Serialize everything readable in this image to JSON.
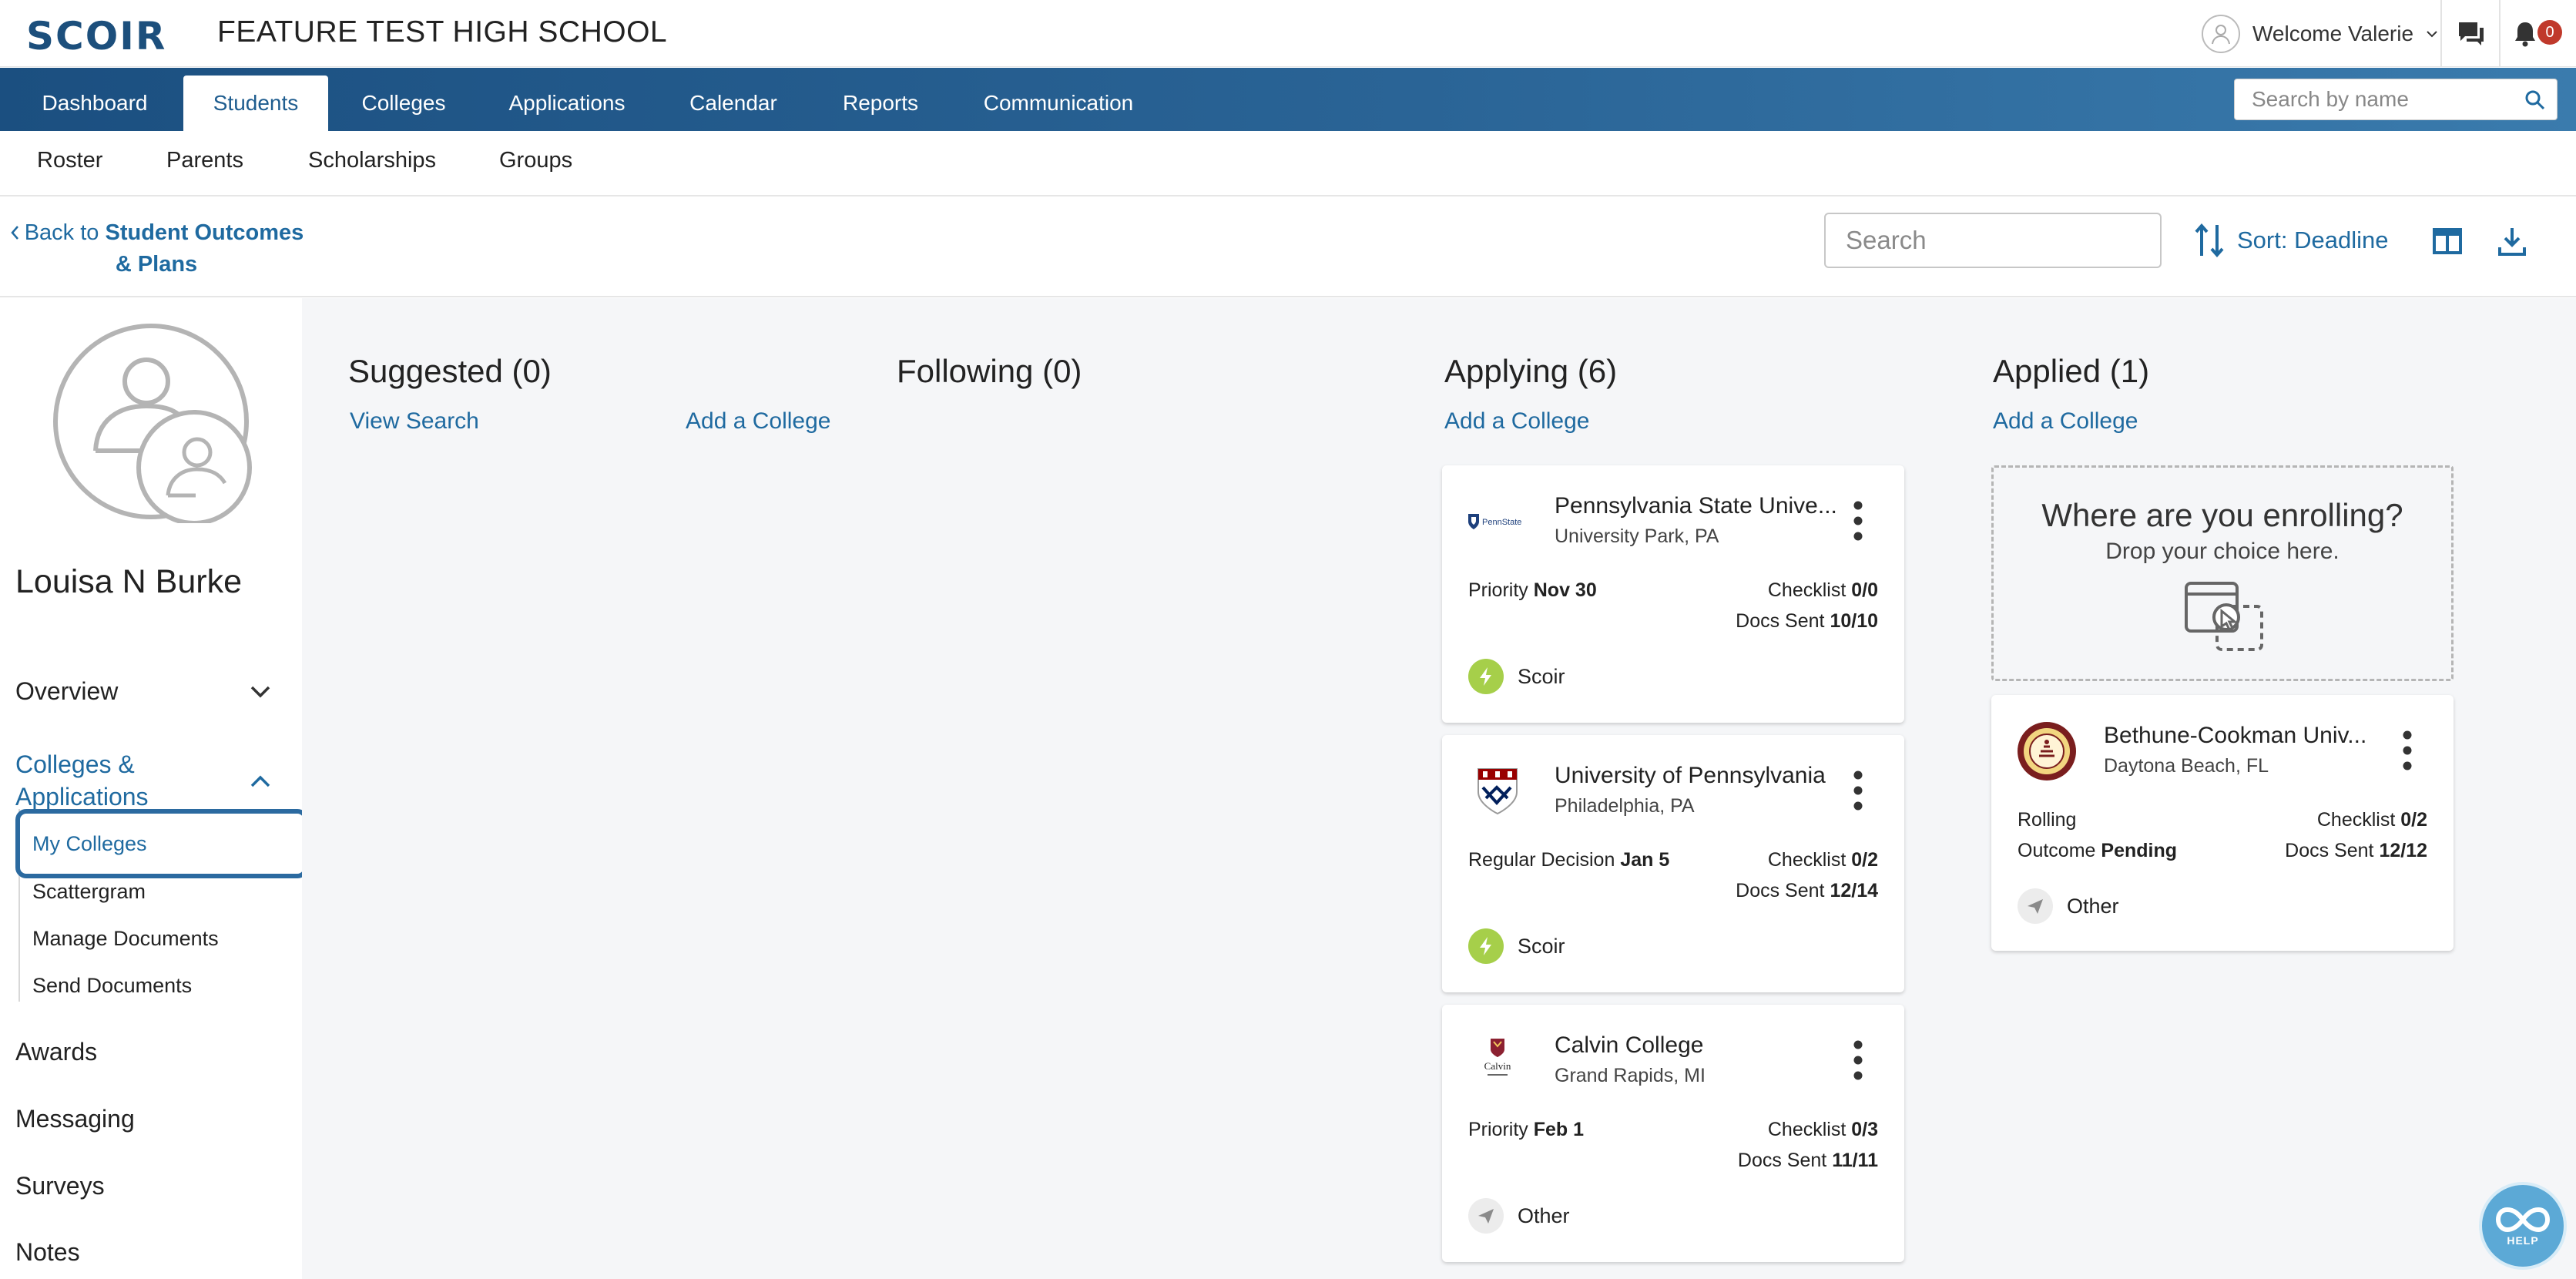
{
  "header": {
    "logo": "SCOIR",
    "school_name": "FEATURE TEST HIGH SCHOOL",
    "welcome": "Welcome Valerie",
    "notification_count": "0"
  },
  "main_nav": {
    "tabs": [
      "Dashboard",
      "Students",
      "Colleges",
      "Applications",
      "Calendar",
      "Reports",
      "Communication"
    ],
    "active": "Students",
    "search_placeholder": "Search by name"
  },
  "sub_nav": {
    "items": [
      "Roster",
      "Parents",
      "Scholarships",
      "Groups"
    ]
  },
  "toolbar": {
    "back_prefix": "Back to ",
    "back_target": "Student Outcomes & Plans",
    "search_placeholder": "Search",
    "sort_label": "Sort: Deadline"
  },
  "sidebar": {
    "student_name": "Louisa N Burke",
    "overview": "Overview",
    "colleges_apps": "Colleges & Applications",
    "sub_items": [
      "My Colleges",
      "Scattergram",
      "Manage Documents",
      "Send Documents"
    ],
    "links": [
      "Awards",
      "Messaging",
      "Surveys",
      "Notes"
    ]
  },
  "columns": {
    "suggested": {
      "title": "Suggested (0)",
      "view_search": "View Search",
      "add": "Add a College"
    },
    "following": {
      "title": "Following (0)"
    },
    "applying": {
      "title": "Applying (6)",
      "add": "Add a College"
    },
    "applied": {
      "title": "Applied (1)",
      "add": "Add a College"
    }
  },
  "applying_cards": [
    {
      "name": "Pennsylvania State Unive...",
      "location": "University Park, PA",
      "deadline_type": "Priority",
      "deadline": "Nov 30",
      "checklist": "0/0",
      "docs_sent": "10/10",
      "method": "Scoir"
    },
    {
      "name": "University of Pennsylvania",
      "location": "Philadelphia, PA",
      "deadline_type": "Regular Decision",
      "deadline": "Jan 5",
      "checklist": "0/2",
      "docs_sent": "12/14",
      "method": "Scoir"
    },
    {
      "name": "Calvin College",
      "location": "Grand Rapids, MI",
      "deadline_type": "Priority",
      "deadline": "Feb 1",
      "checklist": "0/3",
      "docs_sent": "11/11",
      "method": "Other"
    }
  ],
  "applied_card": {
    "name": "Bethune-Cookman Univ...",
    "location": "Daytona Beach, FL",
    "deadline_type": "Rolling",
    "outcome_label": "Outcome",
    "outcome": "Pending",
    "checklist": "0/2",
    "docs_sent": "12/12",
    "method": "Other"
  },
  "dropzone": {
    "title": "Where are you enrolling?",
    "subtitle": "Drop your choice here."
  },
  "labels": {
    "checklist": "Checklist",
    "docs_sent": "Docs Sent",
    "help": "HELP"
  },
  "logo_text": {
    "penn_state": "PennState",
    "calvin": "Calvin"
  },
  "colors": {
    "nav_blue": "#1b4f80",
    "link_blue": "#1f6aa0",
    "scoir_green": "#a6cf4a",
    "badge_red": "#c0392b"
  }
}
